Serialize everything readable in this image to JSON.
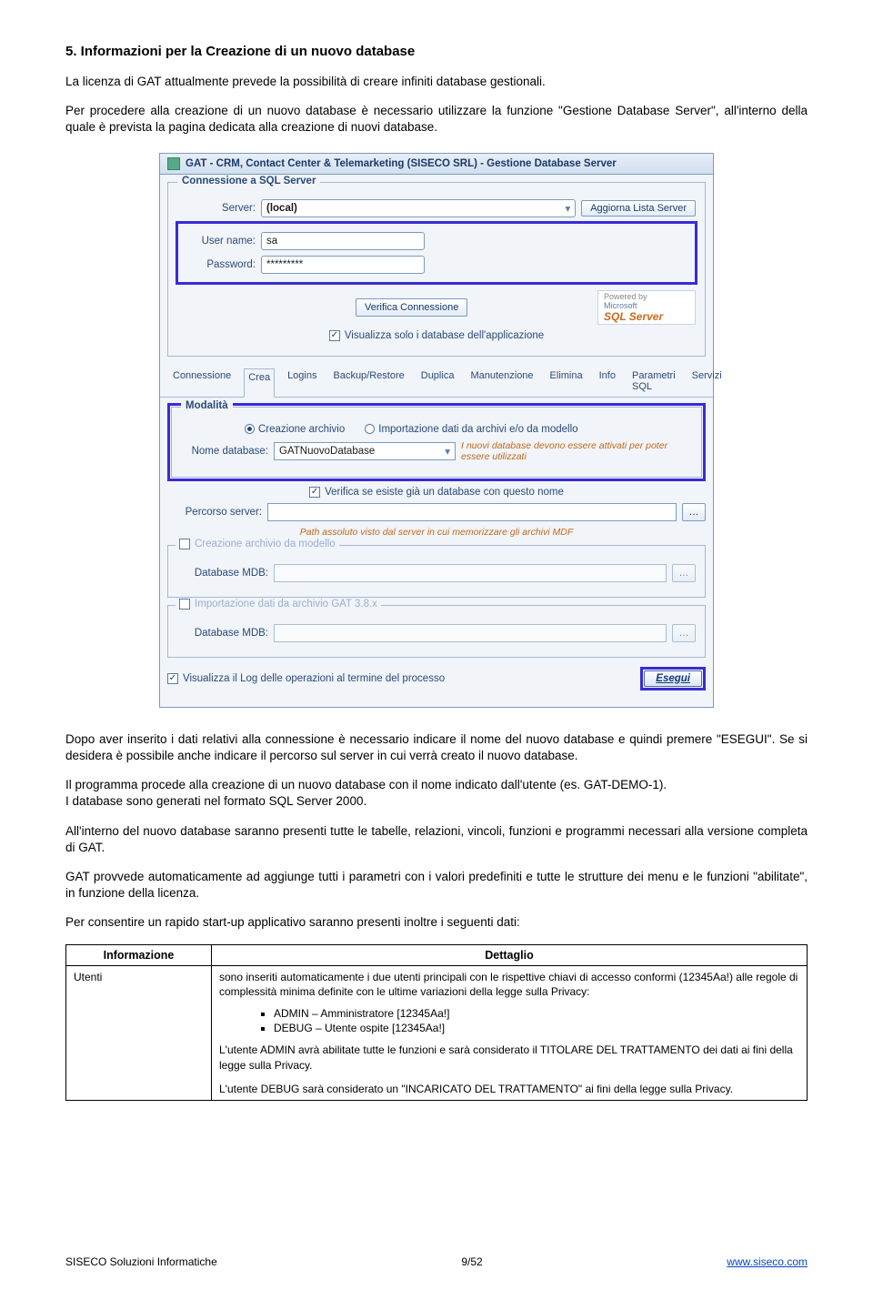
{
  "section": {
    "heading": "5. Informazioni per la Creazione di un nuovo database",
    "p1": "La licenza di GAT attualmente prevede la possibilità di creare infiniti database gestionali.",
    "p2": "Per procedere alla creazione di un nuovo database è necessario utilizzare la funzione \"Gestione Database Server\", all'interno della quale è prevista la pagina dedicata alla creazione di nuovi database."
  },
  "app": {
    "title": "GAT - CRM, Contact Center & Telemarketing (SISECO SRL) - Gestione Database Server",
    "conn": {
      "legend": "Connessione a SQL Server",
      "server_lbl": "Server:",
      "server_val": "(local)",
      "aggiorna_btn": "Aggiorna Lista Server",
      "user_lbl": "User name:",
      "user_val": "sa",
      "pass_lbl": "Password:",
      "pass_val": "*********",
      "verify_btn": "Verifica Connessione",
      "viewonly_chk": "Visualizza solo i database dell'applicazione",
      "powered_lbl": "Powered by",
      "ms": "Microsoft",
      "sql": "SQL Server"
    },
    "tabs": [
      "Connessione",
      "Crea",
      "Logins",
      "Backup/Restore",
      "Duplica",
      "Manutenzione",
      "Elimina",
      "Info",
      "Parametri SQL",
      "Servizi"
    ],
    "crea": {
      "modalita_legend": "Modalità",
      "radio1": "Creazione archivio",
      "radio2": "Importazione dati da archivi e/o da modello",
      "nome_lbl": "Nome database:",
      "nome_val": "GATNuovoDatabase",
      "hint_attiva": "I nuovi database devono essere attivati per poter essere utilizzati",
      "verify_chk": "Verifica se esiste già un database con questo nome",
      "percorso_lbl": "Percorso server:",
      "percorso_hint": "Path assoluto visto dal server in cui memorizzare gli archivi MDF",
      "model_chk": "Creazione archivio da modello",
      "mdb1_lbl": "Database MDB:",
      "import_chk": "Importazione dati da archivio GAT 3.8.x",
      "mdb2_lbl": "Database MDB:",
      "log_chk": "Visualizza il Log delle operazioni al termine del processo",
      "exec_btn": "Esegui"
    }
  },
  "body": {
    "p3": "Dopo aver inserito i dati relativi alla connessione è necessario indicare il nome del nuovo database e quindi premere \"ESEGUI\". Se si desidera è possibile anche indicare il percorso sul server in cui verrà creato il nuovo database.",
    "p4": "Il programma procede alla creazione di un nuovo database con il nome indicato dall'utente (es. GAT-DEMO-1).",
    "p4b": "I database sono generati nel formato SQL Server 2000.",
    "p5": "All'interno del nuovo database saranno presenti tutte le tabelle, relazioni, vincoli, funzioni e programmi necessari alla versione completa di GAT.",
    "p6": "GAT provvede automaticamente ad aggiunge tutti i parametri con i valori predefiniti e tutte le strutture dei menu e le funzioni \"abilitate\", in funzione della licenza.",
    "p7": "Per consentire un rapido start-up applicativo saranno presenti inoltre i seguenti dati:"
  },
  "table": {
    "h1": "Informazione",
    "h2": "Dettaglio",
    "row1_key": "Utenti",
    "row1_det_intro": "sono inseriti automaticamente i due utenti principali con le rispettive chiavi di accesso conformi (12345Aa!) alle regole di complessità minima definite con le ultime variazioni della legge sulla Privacy:",
    "row1_li1": "ADMIN – Amministratore [12345Aa!]",
    "row1_li2": "DEBUG – Utente ospite [12345Aa!]",
    "row1_p2": "L'utente ADMIN avrà abilitate tutte le funzioni e sarà considerato il TITOLARE DEL TRATTAMENTO dei dati ai fini della legge sulla Privacy.",
    "row1_p3": "L'utente DEBUG sarà considerato un \"INCARICATO DEL TRATTAMENTO\" ai fini della legge sulla Privacy."
  },
  "footer": {
    "left": "SISECO Soluzioni Informatiche",
    "center": "9/52",
    "right": "www.siseco.com"
  }
}
